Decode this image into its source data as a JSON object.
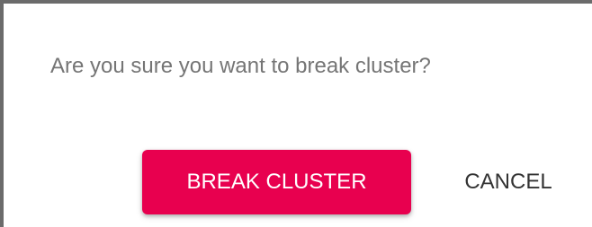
{
  "dialog": {
    "message": "Are you sure you want to break cluster?",
    "confirm_label": "BREAK CLUSTER",
    "cancel_label": "CANCEL"
  },
  "colors": {
    "accent": "#e8004f",
    "message_text": "#757575",
    "cancel_text": "#333333"
  }
}
